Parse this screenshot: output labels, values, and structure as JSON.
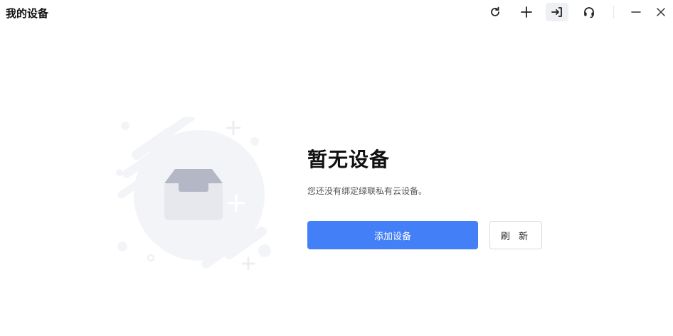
{
  "window": {
    "title": "我的设备",
    "toolbar": [
      {
        "icon": "refresh-icon"
      },
      {
        "icon": "plus-icon"
      },
      {
        "icon": "login-arrow-icon",
        "active": true
      },
      {
        "icon": "headset-icon"
      }
    ],
    "controls": [
      "minimize-icon",
      "close-icon"
    ]
  },
  "empty_state": {
    "title": "暂无设备",
    "description": "您还没有绑定绿联私有云设备。",
    "add_button": "添加设备",
    "refresh_button": "刷 新"
  },
  "colors": {
    "accent": "#4380f7",
    "illustration_bg": "#f3f4f7",
    "box_top": "#b4b7c6",
    "box_body": "#e6e8ee"
  }
}
